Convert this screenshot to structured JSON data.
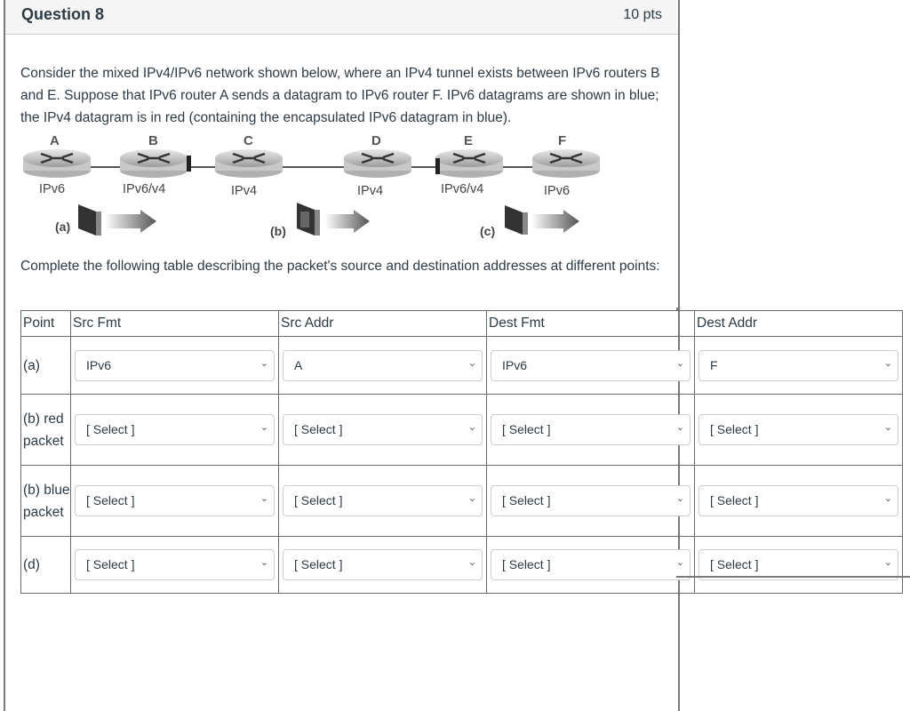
{
  "question": {
    "title": "Question 8",
    "points": "10 pts",
    "prompt": "Consider the mixed IPv4/IPv6 network shown below, where an IPv4 tunnel exists between IPv6 routers B and E. Suppose that IPv6 router A sends a datagram to IPv6 router F.  IPv6 datagrams are shown in blue; the IPv4 datagram is in red (containing the encapsulated IPv6 datagram in blue).",
    "instruction": "Complete the following table describing the packet's source and destination addresses at different points:"
  },
  "diagram": {
    "routers": [
      {
        "name": "A",
        "type": "IPv6"
      },
      {
        "name": "B",
        "type": "IPv6/v4"
      },
      {
        "name": "C",
        "type": "IPv4"
      },
      {
        "name": "D",
        "type": "IPv4"
      },
      {
        "name": "E",
        "type": "IPv6/v4"
      },
      {
        "name": "F",
        "type": "IPv6"
      }
    ],
    "packets": [
      {
        "label": "(a)"
      },
      {
        "label": "(b)"
      },
      {
        "label": "(c)"
      }
    ]
  },
  "table": {
    "headers": [
      "Point",
      "Src Fmt",
      "Src Addr",
      "Dest Fmt",
      "Dest Addr"
    ],
    "rows": [
      {
        "point": "(a)",
        "cells": [
          "IPv6",
          "A",
          "IPv6",
          "F"
        ]
      },
      {
        "point": "(b) red packet",
        "cells": [
          "[ Select ]",
          "[ Select ]",
          "[ Select ]",
          "[ Select ]"
        ]
      },
      {
        "point": "(b) blue packet",
        "cells": [
          "[ Select ]",
          "[ Select ]",
          "[ Select ]",
          "[ Select ]"
        ]
      },
      {
        "point": "(d)",
        "cells": [
          "[ Select ]",
          "[ Select ]",
          "[ Select ]",
          "[ Select ]"
        ]
      }
    ],
    "chevron": "⌄"
  }
}
